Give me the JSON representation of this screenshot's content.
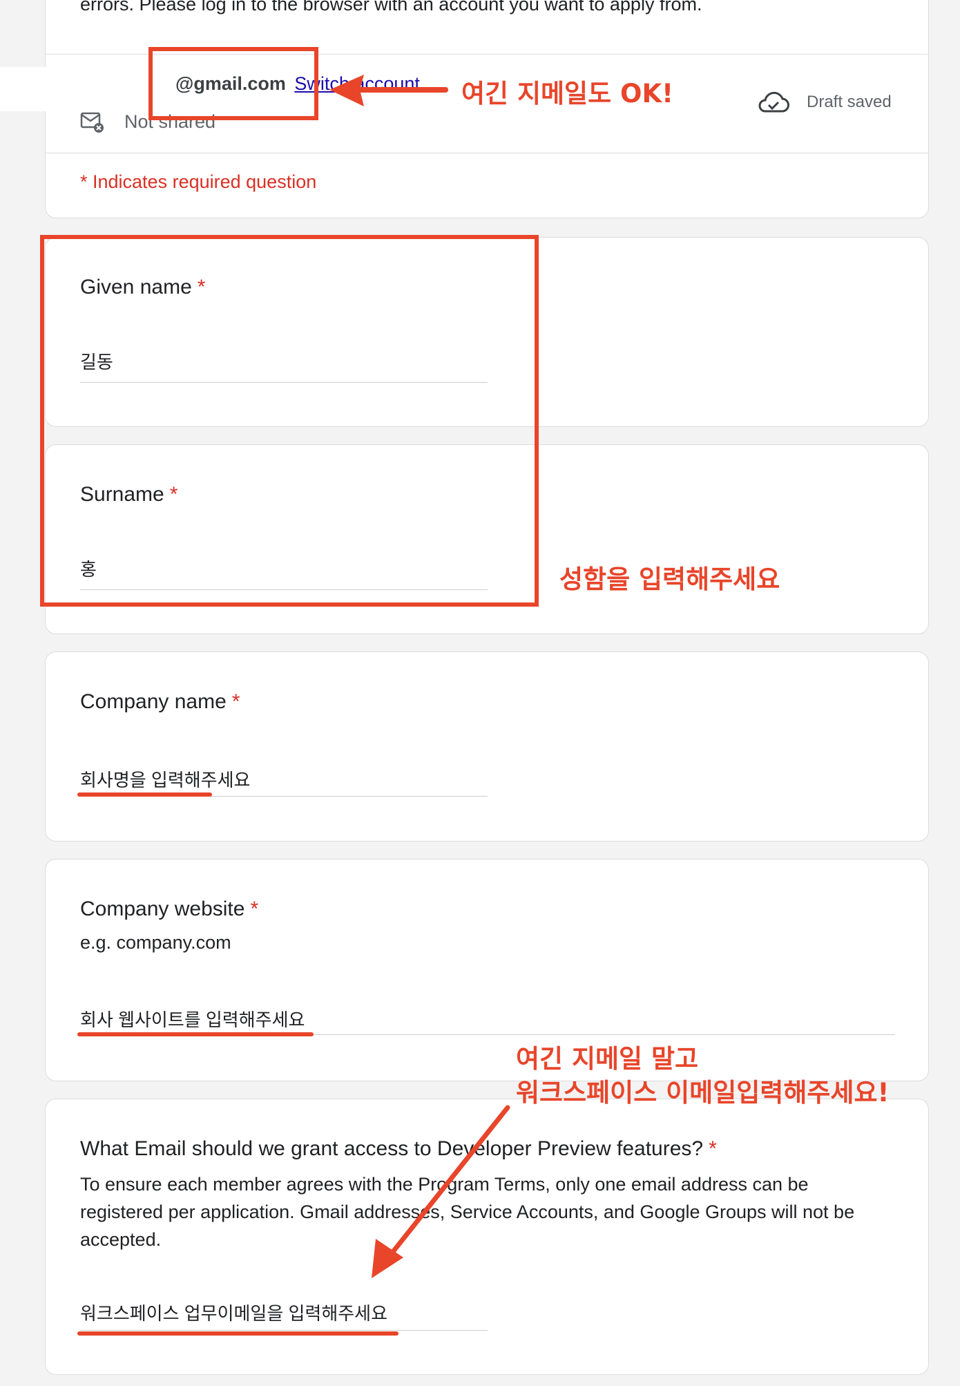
{
  "header": {
    "top_text": "errors. Please log in to the browser with an account you want to apply from.",
    "account_email": "@gmail.com",
    "switch_account": "Switch account",
    "not_shared": "Not shared",
    "draft_status": "Draft saved",
    "required_note": "* Indicates required question"
  },
  "questions": {
    "given_name": {
      "label": "Given name",
      "required": "*",
      "value": "길동"
    },
    "surname": {
      "label": "Surname",
      "required": "*",
      "value": "홍"
    },
    "company_name": {
      "label": "Company name",
      "required": "*",
      "value": "회사명을 입력해주세요"
    },
    "company_website": {
      "label": "Company website",
      "required": "*",
      "description": "e.g. company.com",
      "value": "회사 웹사이트를 입력해주세요"
    },
    "email": {
      "label": "What Email should we grant access to Developer Preview features?",
      "required": "*",
      "description": "To ensure each member agrees with the Program Terms, only one email address can be registered per application. Gmail addresses, Service Accounts, and Google Groups will not be accepted.",
      "value": "워크스페이스 업무이메일을 입력해주세요"
    }
  },
  "annotations": {
    "gmail_ok": "여긴 지메일도 OK!",
    "enter_name": "성함을 입력해주세요",
    "workspace_line1": "여긴 지메일 말고",
    "workspace_line2": "워크스페이스 이메일입력해주세요!"
  },
  "icons": {
    "mail": "mail-off-icon",
    "cloud": "cloud-done-icon"
  },
  "colors": {
    "annotation": "#e8452a",
    "required": "#d93025",
    "link": "#1a0dab"
  }
}
